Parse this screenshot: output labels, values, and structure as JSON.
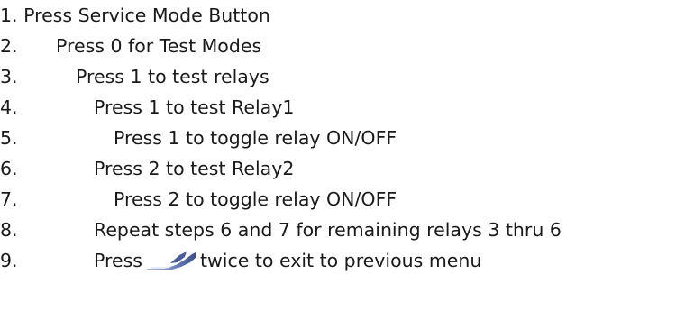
{
  "steps": [
    {
      "number": "1.",
      "text": "Press Service Mode Button"
    },
    {
      "number": "2.",
      "text": "Press 0 for Test Modes"
    },
    {
      "number": "3.",
      "text": "Press 1 to test relays"
    },
    {
      "number": "4.",
      "text": "Press 1 to test Relay1"
    },
    {
      "number": "5.",
      "text": "Press 1 to toggle relay ON/OFF"
    },
    {
      "number": "6.",
      "text": "Press 2 to test Relay2"
    },
    {
      "number": "7.",
      "text": "Press 2 to toggle relay ON/OFF"
    },
    {
      "number": "8.",
      "text": "Repeat steps 6 and 7 for remaining relays 3 thru 6"
    },
    {
      "number": "9.",
      "text_before": "Press",
      "icon": "back-arrow-icon",
      "text_after": "twice to exit to previous menu"
    }
  ],
  "colors": {
    "text": "#1a1a1a",
    "icon_dark": "#3d4f86",
    "icon_light": "#9fb4de"
  }
}
